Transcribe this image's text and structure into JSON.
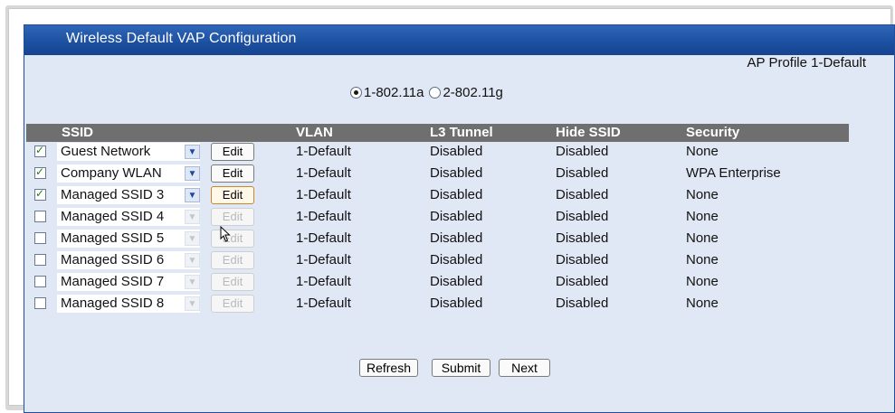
{
  "window": {
    "title": "Wireless Default VAP Configuration",
    "profile_label": "AP Profile 1-Default"
  },
  "radio_options": [
    {
      "label": "1-802.11a",
      "selected": true
    },
    {
      "label": "2-802.11g",
      "selected": false
    }
  ],
  "table": {
    "headers": {
      "ssid": "SSID",
      "vlan": "VLAN",
      "l3": "L3 Tunnel",
      "hide": "Hide SSID",
      "security": "Security"
    },
    "rows": [
      {
        "checked": true,
        "ssid": "Guest Network",
        "edit": "Edit",
        "vlan": "1-Default",
        "l3": "Disabled",
        "hide": "Disabled",
        "security": "None"
      },
      {
        "checked": true,
        "ssid": "Company WLAN",
        "edit": "Edit",
        "vlan": "1-Default",
        "l3": "Disabled",
        "hide": "Disabled",
        "security": "WPA Enterprise"
      },
      {
        "checked": true,
        "ssid": "Managed SSID 3",
        "edit": "Edit",
        "vlan": "1-Default",
        "l3": "Disabled",
        "hide": "Disabled",
        "security": "None"
      },
      {
        "checked": false,
        "ssid": "Managed SSID 4",
        "edit": "Edit",
        "vlan": "1-Default",
        "l3": "Disabled",
        "hide": "Disabled",
        "security": "None"
      },
      {
        "checked": false,
        "ssid": "Managed SSID 5",
        "edit": "Edit",
        "vlan": "1-Default",
        "l3": "Disabled",
        "hide": "Disabled",
        "security": "None"
      },
      {
        "checked": false,
        "ssid": "Managed SSID 6",
        "edit": "Edit",
        "vlan": "1-Default",
        "l3": "Disabled",
        "hide": "Disabled",
        "security": "None"
      },
      {
        "checked": false,
        "ssid": "Managed SSID 7",
        "edit": "Edit",
        "vlan": "1-Default",
        "l3": "Disabled",
        "hide": "Disabled",
        "security": "None"
      },
      {
        "checked": false,
        "ssid": "Managed SSID 8",
        "edit": "Edit",
        "vlan": "1-Default",
        "l3": "Disabled",
        "hide": "Disabled",
        "security": "None"
      }
    ]
  },
  "buttons": {
    "refresh": "Refresh",
    "submit": "Submit",
    "next": "Next"
  },
  "colors": {
    "titlebar": "#1c4f9f",
    "panel_bg": "#e1e8f5",
    "header_bg": "#6f6f6f"
  }
}
